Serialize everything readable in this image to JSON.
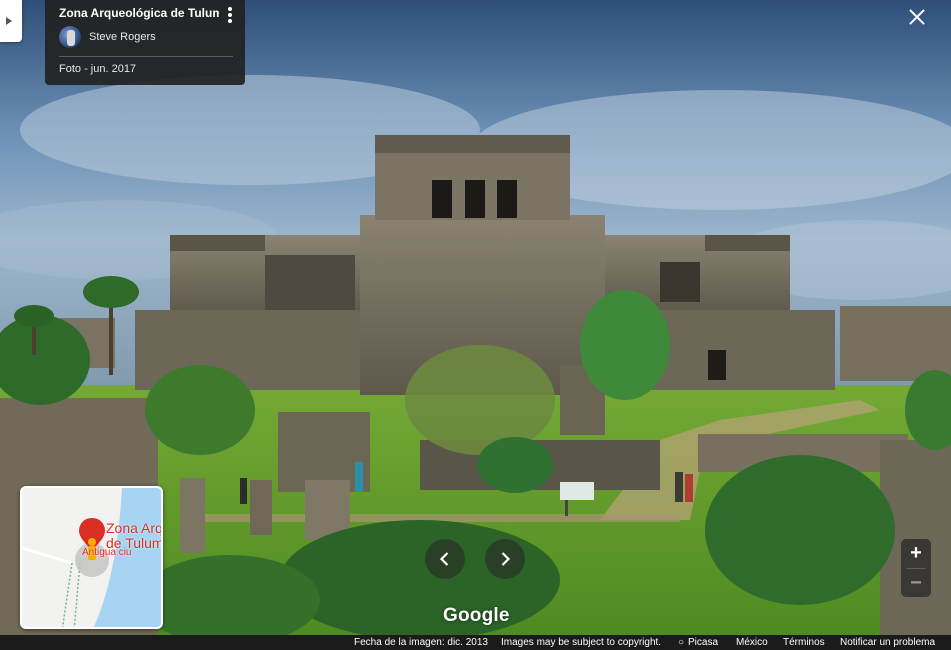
{
  "info_card": {
    "title": "Zona Arqueológica de Tulum",
    "author": "Steve Rogers",
    "date": "Foto - jun. 2017"
  },
  "map": {
    "place_line1": "Zona Arq",
    "place_line2": "de Tulum",
    "place_sub": "Antigua ciu"
  },
  "zoom": {
    "in_label": "+",
    "out_label": "−"
  },
  "logo": "Google",
  "footer": {
    "image_date": "Fecha de la imagen: dic. 2013",
    "copyright": "Images may be subject to copyright.",
    "picasa": "Picasa",
    "country": "México",
    "terms": "Términos",
    "report": "Notificar un problema"
  },
  "colors": {
    "map_pin": "#d93025",
    "panel_bg": "#222222",
    "water": "#a6d4f2"
  },
  "icons": [
    "chevron-left-icon",
    "chevron-right-icon",
    "close-icon",
    "more-vert-icon",
    "pegman-icon",
    "map-pin-icon",
    "picasa-icon"
  ]
}
